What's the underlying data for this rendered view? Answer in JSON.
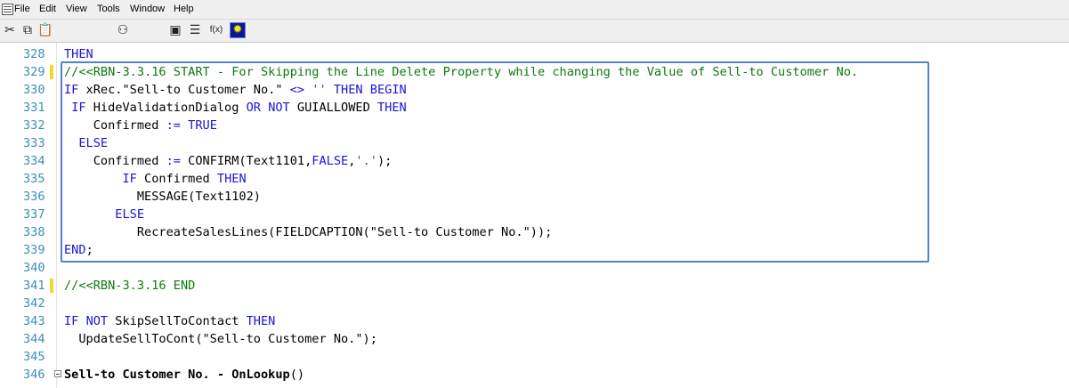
{
  "menubar": {
    "items": [
      "File",
      "Edit",
      "View",
      "Tools",
      "Window",
      "Help"
    ]
  },
  "toolbar": {
    "buttons": [
      {
        "name": "cut",
        "icon": "scissors-icon"
      },
      {
        "name": "copy",
        "icon": "copy-icon"
      },
      {
        "name": "paste",
        "icon": "paste-icon"
      },
      {
        "name": "find",
        "icon": "binoculars-icon"
      },
      {
        "name": "properties",
        "icon": "properties-icon"
      },
      {
        "name": "list",
        "icon": "list-icon"
      },
      {
        "name": "function",
        "icon": "function-icon",
        "label": "f(x)"
      },
      {
        "name": "symbol",
        "icon": "sun-icon"
      }
    ]
  },
  "editor": {
    "colors": {
      "keyword": "#1b14d6",
      "comment": "#0e7a0e",
      "string": "#7a2a9c",
      "line_number": "#3a8fb7",
      "change_marker": "#f2d82a",
      "highlight_box": "#5880cc"
    },
    "lines": [
      {
        "num": "328",
        "code": "THEN"
      },
      {
        "num": "329",
        "code": "//<<RBN-3.3.16 START - For Skipping the Line Delete Property while changing the Value of Sell-to Customer No."
      },
      {
        "num": "330",
        "code": "IF xRec.\"Sell-to Customer No.\" <> '' THEN BEGIN"
      },
      {
        "num": "331",
        "code": " IF HideValidationDialog OR NOT GUIALLOWED THEN"
      },
      {
        "num": "332",
        "code": "    Confirmed := TRUE"
      },
      {
        "num": "333",
        "code": "  ELSE"
      },
      {
        "num": "334",
        "code": "    Confirmed := CONFIRM(Text1101,FALSE,'.');"
      },
      {
        "num": "335",
        "code": "        IF Confirmed THEN"
      },
      {
        "num": "336",
        "code": "          MESSAGE(Text1102)"
      },
      {
        "num": "337",
        "code": "       ELSE"
      },
      {
        "num": "338",
        "code": "          RecreateSalesLines(FIELDCAPTION(\"Sell-to Customer No.\"));"
      },
      {
        "num": "339",
        "code": "END;"
      },
      {
        "num": "340",
        "code": ""
      },
      {
        "num": "341",
        "code": "//<<RBN-3.3.16 END"
      },
      {
        "num": "342",
        "code": ""
      },
      {
        "num": "343",
        "code": "IF NOT SkipSellToContact THEN"
      },
      {
        "num": "344",
        "code": "  UpdateSellToCont(\"Sell-to Customer No.\");"
      },
      {
        "num": "345",
        "code": ""
      },
      {
        "num": "346",
        "code": "Sell-to Customer No. - OnLookup()"
      }
    ]
  }
}
